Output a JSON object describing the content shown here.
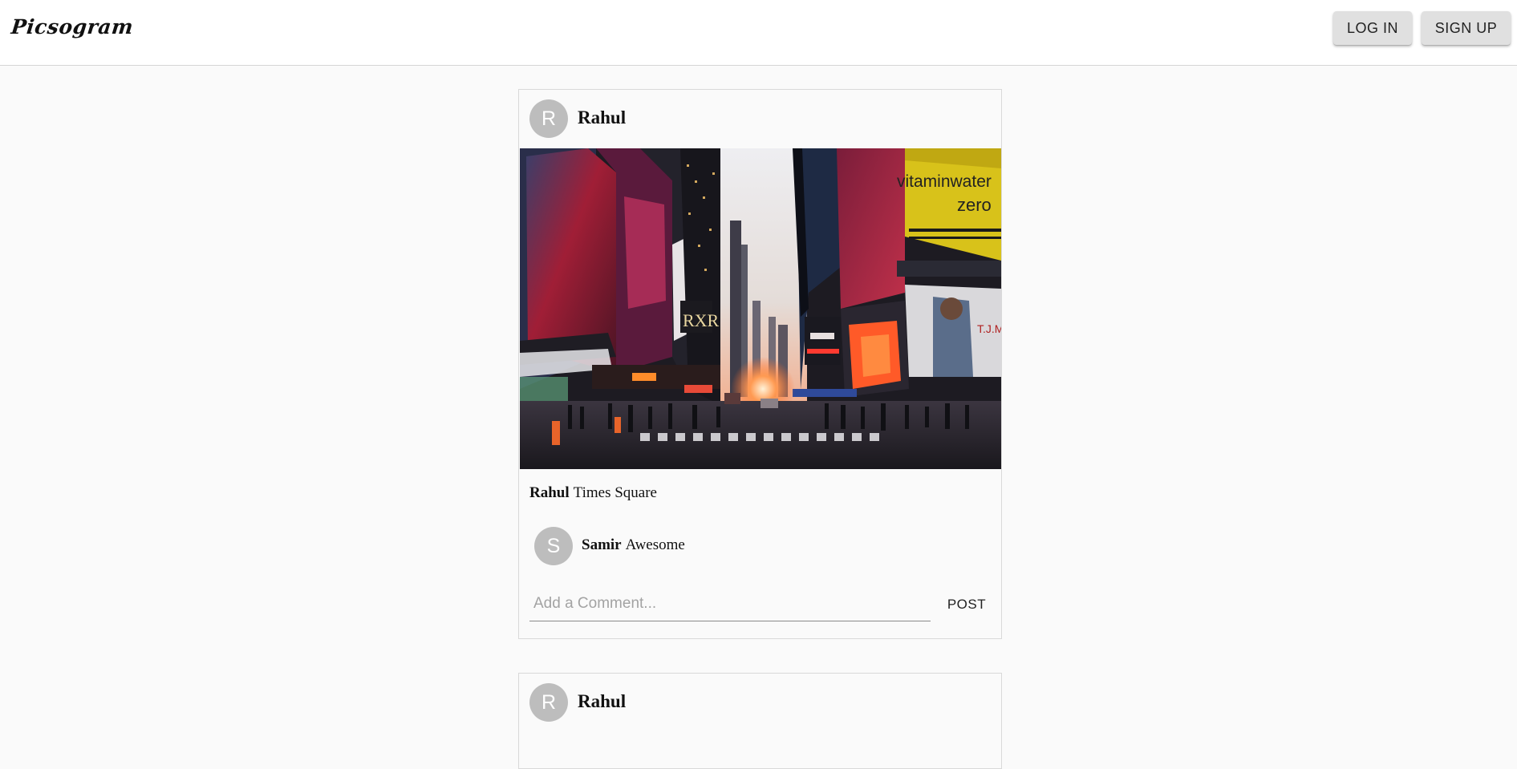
{
  "header": {
    "logo": "Picsogram",
    "login_label": "LOG IN",
    "signup_label": "SIGN UP"
  },
  "posts": [
    {
      "author_initial": "R",
      "author": "Rahul",
      "image_alt": "Times Square",
      "caption_author": "Rahul",
      "caption_text": "Times Square",
      "comments": [
        {
          "initial": "S",
          "author": "Samir",
          "text": "Awesome"
        }
      ],
      "comment_placeholder": "Add a Comment...",
      "post_button": "POST"
    },
    {
      "author_initial": "R",
      "author": "Rahul"
    }
  ],
  "colors": {
    "page_bg": "#fafafa",
    "header_bg": "#ffffff",
    "button_bg": "#e0e0e0",
    "avatar_bg": "#bdbdbd"
  }
}
